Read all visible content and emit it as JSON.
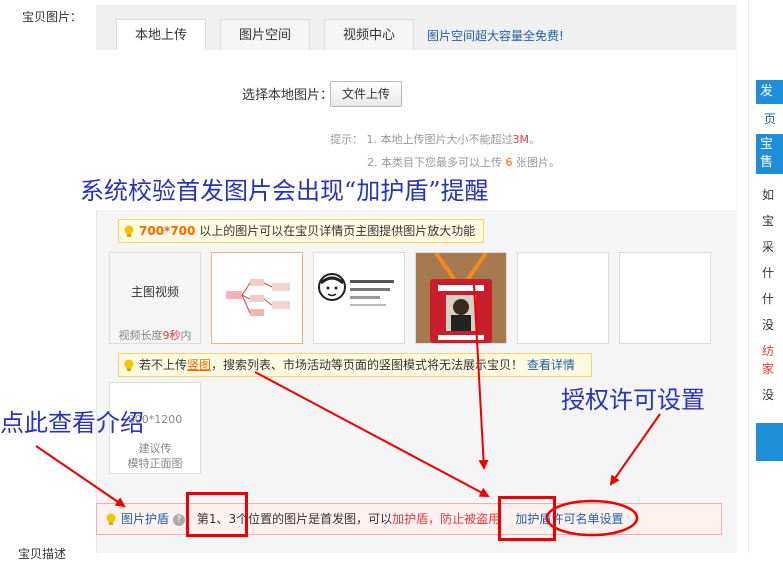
{
  "section": {
    "label": "宝贝图片：",
    "bottom_label": "宝贝描述"
  },
  "tabs": [
    {
      "label": "本地上传",
      "active": true
    },
    {
      "label": "图片空间",
      "active": false
    },
    {
      "label": "视频中心",
      "active": false
    }
  ],
  "tabs_promo": "图片空间超大容量全免费!",
  "upload": {
    "select_label": "选择本地图片：",
    "button_label": "文件上传",
    "tip_prefix": "提示：",
    "tip1_pre": "1.  本地上传图片大小不能超过",
    "tip1_size": "3M",
    "tip1_post": "。",
    "tip2_pre": "2.  本类目下您最多可以上传 ",
    "tip2_count": "6",
    "tip2_post": " 张图片。"
  },
  "zoom_banner": {
    "size": "700*700",
    "text": " 以上的图片可以在宝贝详情页主图提供图片放大功能"
  },
  "video_slot": {
    "title": "主图视频",
    "sub_pre": "视频长度",
    "sub_val": "9秒",
    "sub_post": "内"
  },
  "vertical_banner": {
    "text_pre": "若不上传",
    "link_vertical": "竖图",
    "text_post": "，搜索列表、市场活动等页面的竖图模式将无法展示宝贝！",
    "link_detail": "查看详情"
  },
  "vertical_slot": {
    "size": "800*1200",
    "hint_line1": "建议传",
    "hint_line2": "模特正面图"
  },
  "shield_bar": {
    "link_name": "图片护盾",
    "text1": "：第1、3个位置的图片是首发图，可以",
    "link_add": "加护盾",
    "text2": "，防止被盗用",
    "action_add": "加护盾",
    "action_whitelist": "许可名单设置"
  },
  "annotations": {
    "headline": "系统校验首发图片会出现“加护盾”提醒",
    "license": "授权许可设置",
    "intro": "点此查看介绍"
  },
  "right_sidebar": {
    "header1": "发",
    "item_page": "页",
    "header2a": "宝",
    "header2b": "售",
    "items": [
      "如",
      "宝",
      "采",
      "什",
      "什",
      "没"
    ],
    "warn_a": "纺",
    "warn_b": "家",
    "last": "没"
  },
  "colors": {
    "accent_blue": "#1f5fa8",
    "annotation_blue": "#2733b8",
    "highlight_red": "#e00000",
    "warning_orange": "#ff6600"
  }
}
